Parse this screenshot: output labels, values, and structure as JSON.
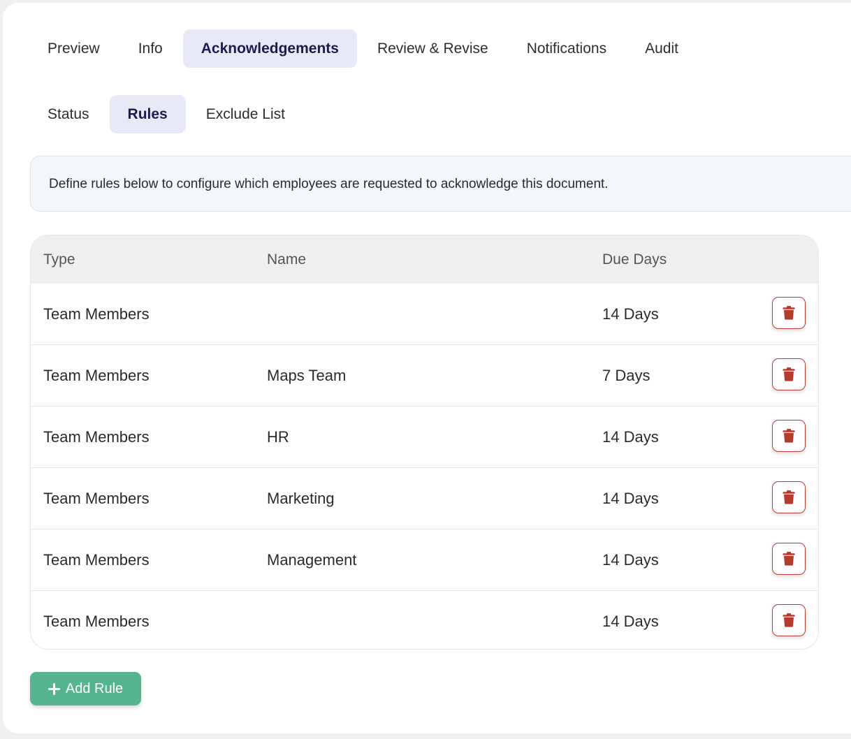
{
  "main_tabs": [
    {
      "label": "Preview",
      "active": false
    },
    {
      "label": "Info",
      "active": false
    },
    {
      "label": "Acknowledgements",
      "active": true
    },
    {
      "label": "Review & Revise",
      "active": false
    },
    {
      "label": "Notifications",
      "active": false
    },
    {
      "label": "Audit",
      "active": false
    }
  ],
  "sub_tabs": [
    {
      "label": "Status",
      "active": false
    },
    {
      "label": "Rules",
      "active": true
    },
    {
      "label": "Exclude List",
      "active": false
    }
  ],
  "banner": {
    "text": "Define rules below to configure which employees are requested to acknowledge this document."
  },
  "table": {
    "headers": {
      "type": "Type",
      "name": "Name",
      "due": "Due Days"
    },
    "rows": [
      {
        "type": "Team Members",
        "name": "",
        "due": "14 Days"
      },
      {
        "type": "Team Members",
        "name": "Maps Team",
        "due": "7 Days"
      },
      {
        "type": "Team Members",
        "name": "HR",
        "due": "14 Days"
      },
      {
        "type": "Team Members",
        "name": "Marketing",
        "due": "14 Days"
      },
      {
        "type": "Team Members",
        "name": "Management",
        "due": "14 Days"
      },
      {
        "type": "Team Members",
        "name": "",
        "due": "14 Days"
      }
    ],
    "row_action_icon": "trash-icon"
  },
  "add_button": {
    "label": "Add Rule",
    "icon": "plus-icon"
  },
  "colors": {
    "active_tab_bg": "#e8e9f6",
    "active_tab_text": "#1d1a4d",
    "delete_red": "#b63a2e",
    "add_green": "#56b48f",
    "banner_bg": "#f3f7fc"
  }
}
